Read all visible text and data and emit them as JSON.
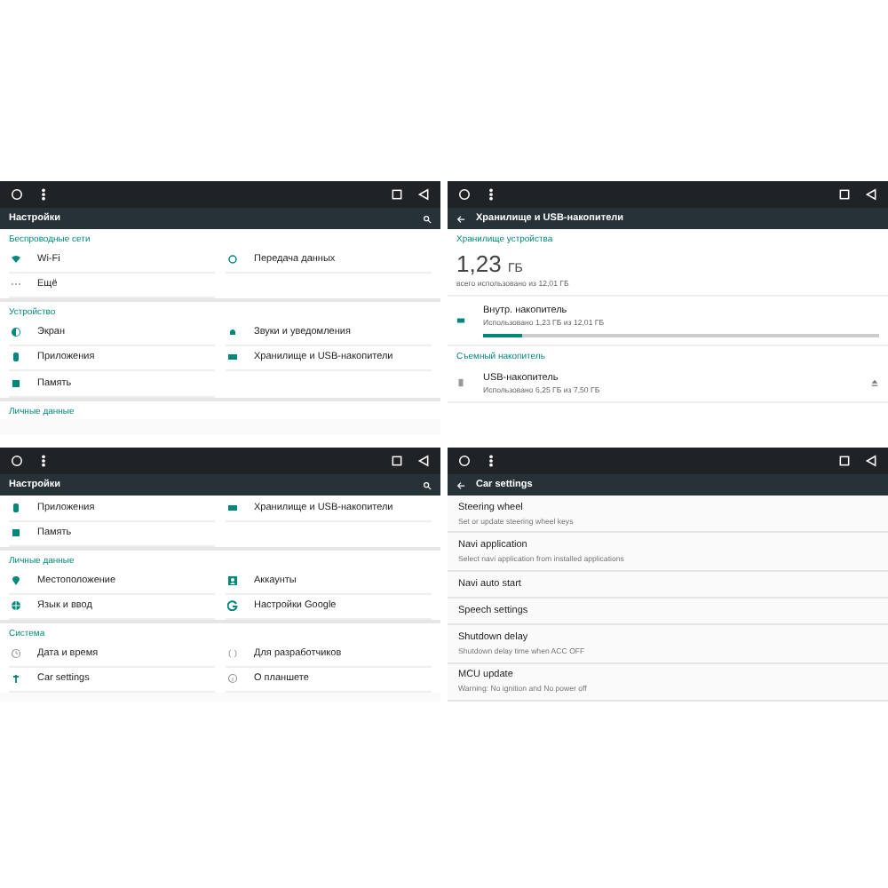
{
  "screens": [
    {
      "kind": "settings",
      "title": "Настройки",
      "sections": [
        {
          "heading": "Беспроводные сети",
          "items": [
            {
              "label": "Wi-Fi"
            },
            {
              "label": "Передача данных"
            },
            {
              "label": "Ещё"
            }
          ]
        },
        {
          "heading": "Устройство",
          "items": [
            {
              "label": "Экран"
            },
            {
              "label": "Звуки и уведомления"
            },
            {
              "label": "Приложения"
            },
            {
              "label": "Хранилище и USB-накопители"
            },
            {
              "label": "Память"
            }
          ]
        },
        {
          "heading": "Личные данные"
        }
      ]
    },
    {
      "kind": "storage",
      "title": "Хранилище и USB-накопители",
      "heading": "Хранилище устройства",
      "used": "1,23",
      "unit": "ГБ",
      "total": "всего использовано из 12,01 ГБ",
      "internal": {
        "name": "Внутр. накопитель",
        "detail": "Использовано 1,23 ГБ из 12,01 ГБ",
        "level": 0.1
      },
      "removable_heading": "Съемный накопитель",
      "removable": {
        "name": "USB-накопитель",
        "detail": "Использовано 6,25 ГБ из 7,50 ГБ"
      }
    },
    {
      "kind": "settings",
      "title": "Настройки",
      "sections": [
        {
          "items": [
            {
              "label": "Приложения"
            },
            {
              "label": "Хранилище и USB-накопители"
            },
            {
              "label": "Память"
            }
          ]
        },
        {
          "heading": "Личные данные",
          "items": [
            {
              "label": "Местоположение"
            },
            {
              "label": "Аккаунты"
            },
            {
              "label": "Язык и ввод"
            },
            {
              "label": "Настройки Google"
            }
          ]
        },
        {
          "heading": "Система",
          "items": [
            {
              "label": "Дата и время"
            },
            {
              "label": "Для разработчиков"
            },
            {
              "label": "Car settings"
            },
            {
              "label": "О планшете"
            }
          ]
        }
      ]
    },
    {
      "kind": "list",
      "title": "Car settings",
      "items": [
        {
          "title": "Steering wheel",
          "subtitle": "Set or update steering wheel keys"
        },
        {
          "title": "Navi application",
          "subtitle": "Select navi application from installed applications"
        },
        {
          "title": "Navi auto start"
        },
        {
          "title": "Speech settings"
        },
        {
          "title": "Shutdown delay",
          "subtitle": "Shutdown delay time when ACC OFF"
        },
        {
          "title": "MCU update",
          "subtitle": "Warning: No ignition and No power off"
        }
      ]
    }
  ]
}
